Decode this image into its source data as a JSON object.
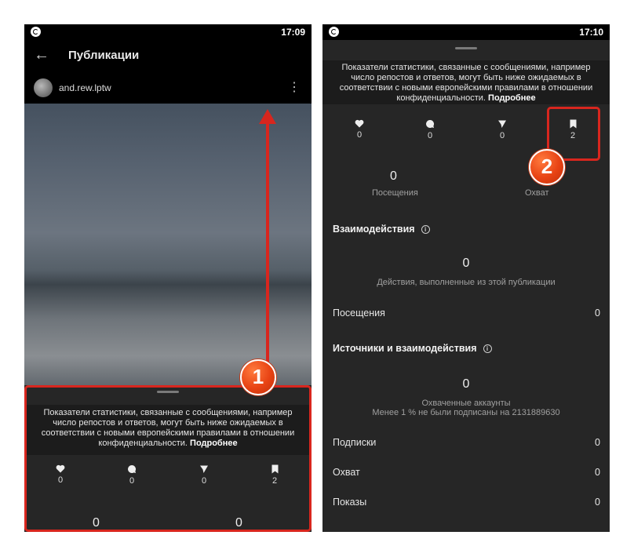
{
  "left_screen": {
    "status_time": "17:09",
    "title": "Публикации",
    "username": "and.rew.lptw",
    "notice_text": "Показатели статистики, связанные с сообщениями, например число репостов и ответов, могут быть ниже ожидаемых в соответствии с новыми европейскими правилами в отношении конфиденциальности.",
    "notice_link": "Подробнее",
    "metrics": [
      {
        "icon": "heart-icon",
        "value": "0"
      },
      {
        "icon": "comment-icon",
        "value": "0"
      },
      {
        "icon": "send-icon",
        "value": "0"
      },
      {
        "icon": "bookmark-icon",
        "value": "2"
      }
    ],
    "bottom_values": [
      "0",
      "0"
    ]
  },
  "right_screen": {
    "status_time": "17:10",
    "notice_text": "Показатели статистики, связанные с сообщениями, например число репостов и ответов, могут быть ниже ожидаемых в соответствии с новыми европейскими правилами в отношении конфиденциальности.",
    "notice_link": "Подробнее",
    "metrics": [
      {
        "icon": "heart-icon",
        "value": "0"
      },
      {
        "icon": "comment-icon",
        "value": "0"
      },
      {
        "icon": "send-icon",
        "value": "0"
      },
      {
        "icon": "bookmark-icon",
        "value": "2"
      }
    ],
    "visits": {
      "value": "0",
      "label": "Посещения"
    },
    "reach": {
      "label": "Охват"
    },
    "interactions": {
      "title": "Взаимодействия",
      "value": "0",
      "caption": "Действия, выполненные из этой публикации",
      "rows": [
        {
          "label": "Посещения",
          "value": "0"
        }
      ]
    },
    "sources": {
      "title": "Источники и взаимодействия",
      "value": "0",
      "caption1": "Охваченные аккаунты",
      "caption2": "Менее 1 % не были подписаны на 2131889630",
      "rows": [
        {
          "label": "Подписки",
          "value": "0"
        },
        {
          "label": "Охват",
          "value": "0"
        },
        {
          "label": "Показы",
          "value": "0"
        }
      ]
    }
  },
  "annotations": {
    "step1": "1",
    "step2": "2",
    "highlight_color": "#d8261e"
  }
}
